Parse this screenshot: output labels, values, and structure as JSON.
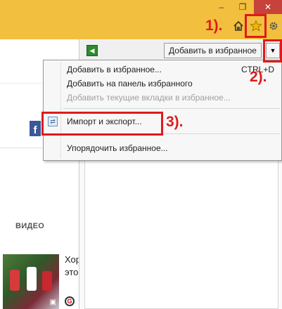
{
  "window": {
    "minimize": "–",
    "restore": "❐",
    "close": "✕"
  },
  "toolbar": {
    "home_icon": "home-icon",
    "favorites_icon": "star-icon",
    "settings_icon": "gear-icon"
  },
  "page": {
    "facebook_glyph": "f",
    "video_heading": "ВИДЕО",
    "news_text_line1": "Хор",
    "news_text_line2": "это",
    "news_source_glyph": "G",
    "camera_glyph": "📷"
  },
  "favorites": {
    "back_glyph": "◀",
    "add_button_label": "Добавить в избранное",
    "dropdown_glyph": "▼"
  },
  "menu": {
    "items": [
      {
        "label": "Добавить в избранное...",
        "shortcut": "CTRL+D",
        "enabled": true
      },
      {
        "label": "Добавить на панель избранного",
        "enabled": true
      },
      {
        "label": "Добавить текущие вкладки в избранное...",
        "enabled": false
      },
      {
        "label": "Импорт и экспорт...",
        "enabled": true
      },
      {
        "label": "Упорядочить избранное...",
        "enabled": true
      }
    ]
  },
  "annotations": {
    "step1": "1).",
    "step2": "2).",
    "step3": "3).",
    "color": "#e01a1a"
  },
  "colors": {
    "toolbar_bg": "#f2bf3e",
    "close_bg": "#c7423a",
    "star": "#f4b400"
  }
}
